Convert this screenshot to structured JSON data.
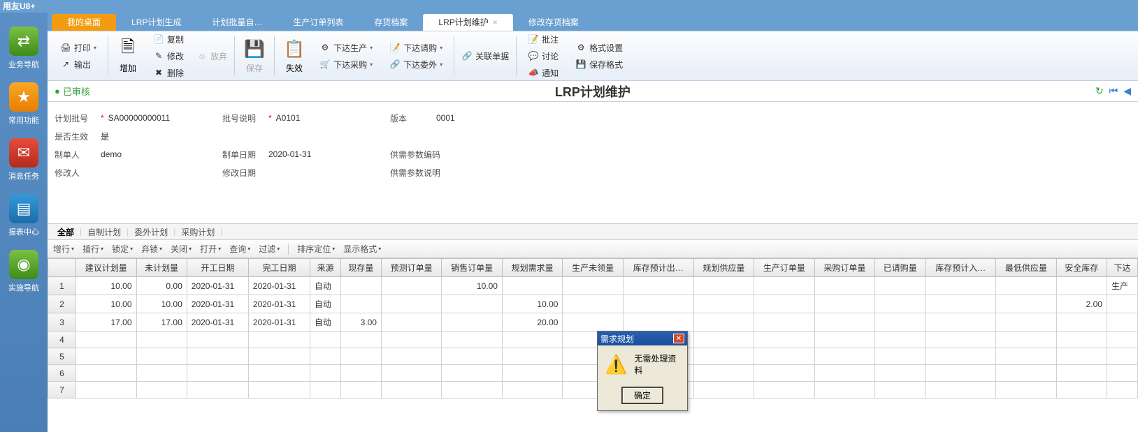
{
  "app_title": "用友U8+",
  "left_nav": [
    {
      "label": "业务导航",
      "icon": "⇄"
    },
    {
      "label": "常用功能",
      "icon": "★"
    },
    {
      "label": "消息任务",
      "icon": "✉"
    },
    {
      "label": "报表中心",
      "icon": "▤"
    },
    {
      "label": "实施导航",
      "icon": "◉"
    }
  ],
  "tabs": [
    {
      "label": "我的桌面",
      "type": "first"
    },
    {
      "label": "LRP计划生成",
      "type": "plain"
    },
    {
      "label": "计划批量自…",
      "type": "plain"
    },
    {
      "label": "生产订单列表",
      "type": "plain"
    },
    {
      "label": "存货档案",
      "type": "plain"
    },
    {
      "label": "LRP计划维护",
      "type": "active"
    },
    {
      "label": "修改存货档案",
      "type": "plain"
    }
  ],
  "toolbar": {
    "print": "打印",
    "output": "输出",
    "add": "增加",
    "copy": "复制",
    "modify": "修改",
    "delete": "删除",
    "discard": "放弃",
    "save": "保存",
    "invalid": "失效",
    "issue_prod": "下达生产",
    "issue_purch": "下达采购",
    "issue_req": "下达请购",
    "issue_out": "下达委外",
    "related": "关联单据",
    "remark": "批注",
    "discuss": "讨论",
    "notify": "通知",
    "format_set": "格式设置",
    "save_format": "保存格式"
  },
  "status_label": "已审核",
  "page_title": "LRP计划维护",
  "form": {
    "plan_no_label": "计划批号",
    "plan_no": "SA00000000011",
    "batch_desc_label": "批号说明",
    "batch_desc": "A0101",
    "version_label": "版本",
    "version": "0001",
    "effective_label": "是否生效",
    "effective": "是",
    "maker_label": "制单人",
    "maker": "demo",
    "make_date_label": "制单日期",
    "make_date": "2020-01-31",
    "supply_code_label": "供需参数编码",
    "modifier_label": "修改人",
    "modify_date_label": "修改日期",
    "supply_desc_label": "供需参数说明"
  },
  "sub_tabs": [
    "全部",
    "自制计划",
    "委外计划",
    "采购计划"
  ],
  "grid_toolbar": [
    "增行",
    "插行",
    "锁定",
    "弃锁",
    "关闭",
    "打开",
    "查询",
    "过滤",
    "|",
    "排序定位",
    "显示格式"
  ],
  "columns": [
    "",
    "建议计划量",
    "未计划量",
    "开工日期",
    "完工日期",
    "来源",
    "现存量",
    "预测订单量",
    "销售订单量",
    "规划需求量",
    "生产未领量",
    "库存预计出…",
    "规划供应量",
    "生产订单量",
    "采购订单量",
    "已请购量",
    "库存预计入…",
    "最低供应量",
    "安全库存",
    "下达"
  ],
  "rows": [
    {
      "n": "1",
      "suggest": "10.00",
      "unplan": "0.00",
      "start": "2020-01-31",
      "end": "2020-01-31",
      "src": "自动",
      "stock": "",
      "forecast": "",
      "sales": "10.00",
      "demand": "",
      "prod_unrecv": "",
      "out": "",
      "supply": "",
      "prod_order": "",
      "purch_order": "",
      "req": "",
      "in": "",
      "min": "",
      "safe": "",
      "rel": "生产"
    },
    {
      "n": "2",
      "suggest": "10.00",
      "unplan": "10.00",
      "start": "2020-01-31",
      "end": "2020-01-31",
      "src": "自动",
      "stock": "",
      "forecast": "",
      "sales": "",
      "demand": "10.00",
      "prod_unrecv": "",
      "out": "",
      "supply": "",
      "prod_order": "",
      "purch_order": "",
      "req": "",
      "in": "",
      "min": "",
      "safe": "2.00",
      "rel": ""
    },
    {
      "n": "3",
      "suggest": "17.00",
      "unplan": "17.00",
      "start": "2020-01-31",
      "end": "2020-01-31",
      "src": "自动",
      "stock": "3.00",
      "forecast": "",
      "sales": "",
      "demand": "20.00",
      "prod_unrecv": "",
      "out": "",
      "supply": "",
      "prod_order": "",
      "purch_order": "",
      "req": "",
      "in": "",
      "min": "",
      "safe": "",
      "rel": ""
    },
    {
      "n": "4"
    },
    {
      "n": "5"
    },
    {
      "n": "6"
    },
    {
      "n": "7"
    }
  ],
  "dialog": {
    "title": "需求规划",
    "message": "无需处理资料",
    "ok": "确定"
  }
}
